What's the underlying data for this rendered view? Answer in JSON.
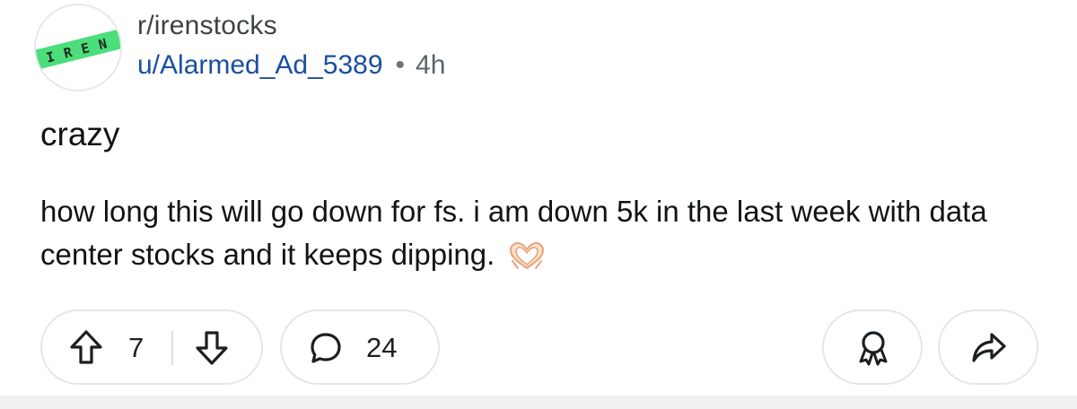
{
  "post": {
    "avatar": {
      "logo_text": "IREN",
      "accent_color": "#4cde7a",
      "icon": "iren-subreddit-logo"
    },
    "subreddit": "r/irenstocks",
    "author": "u/Alarmed_Ad_5389",
    "separator": "•",
    "time_ago": "4h",
    "title": "crazy",
    "body": "how long this will go down for fs. i am down 5k in the last week with data center stocks and it keeps dipping.",
    "emoji": "heart-hands-emoji"
  },
  "actions": {
    "upvote_icon": "upvote-arrow-icon",
    "vote_count": "7",
    "downvote_icon": "downvote-arrow-icon",
    "comment_icon": "comment-bubble-icon",
    "comment_count": "24",
    "award_icon": "award-icon",
    "share_icon": "share-arrow-icon"
  },
  "colors": {
    "username": "#1a4fa0",
    "text": "#111416",
    "muted": "#5b6469",
    "border": "#e4e6e8"
  }
}
